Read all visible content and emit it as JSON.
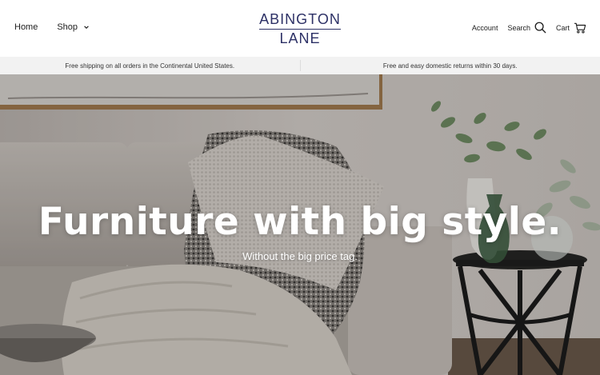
{
  "header": {
    "nav_left": {
      "home_label": "Home",
      "shop_label": "Shop"
    },
    "logo": {
      "line1": "ABINGTON",
      "line2": "LANE"
    },
    "nav_right": {
      "account_label": "Account",
      "search_label": "Search",
      "cart_label": "Cart"
    },
    "icons": {
      "search": "search-icon",
      "cart": "cart-icon",
      "shop_chevron": "chevron-down-icon"
    },
    "colors": {
      "logo": "#2d3166"
    }
  },
  "announcement": {
    "items": [
      "Free shipping on all orders in the Continental United States.",
      "Free and easy domestic returns within 30 days."
    ]
  },
  "hero": {
    "title": "Furniture with big style.",
    "subtitle": "Without the big price tag."
  }
}
